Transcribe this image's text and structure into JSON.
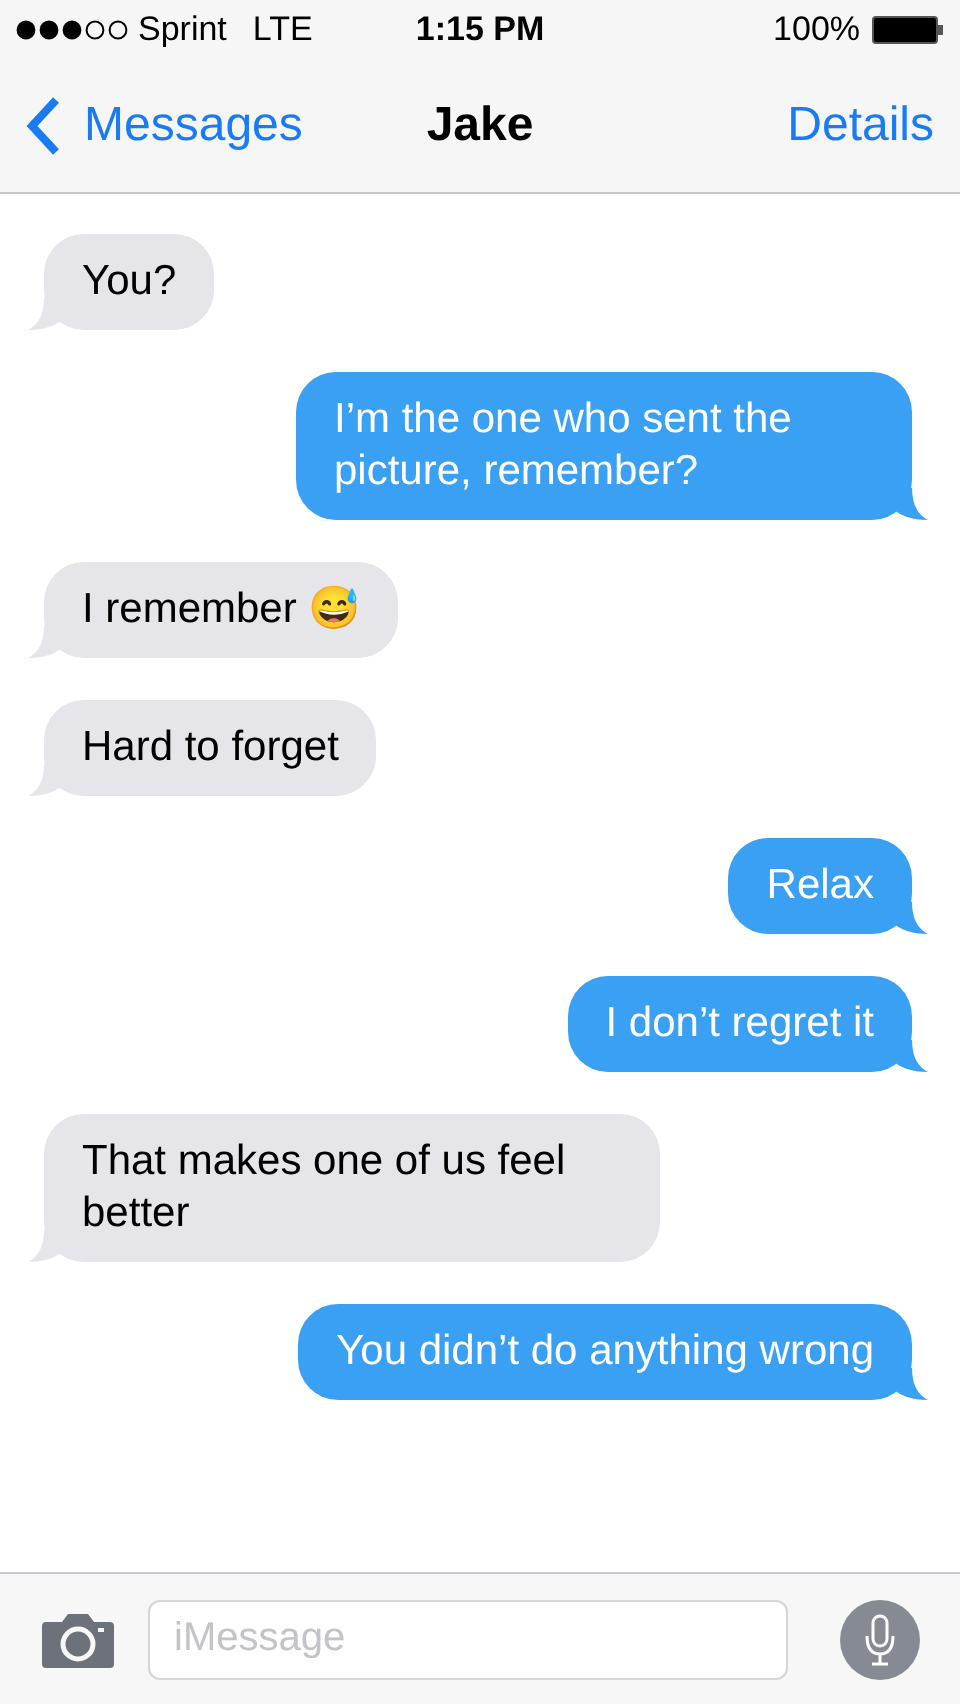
{
  "status_bar": {
    "carrier": "Sprint",
    "network": "LTE",
    "time": "1:15 PM",
    "battery": "100%"
  },
  "nav": {
    "back": "Messages",
    "title": "Jake",
    "action": "Details"
  },
  "messages": [
    {
      "kind": "received",
      "text": "You?"
    },
    {
      "kind": "sent",
      "text": "I’m the one who sent the picture, remember?"
    },
    {
      "kind": "received",
      "text": "I remember 😅"
    },
    {
      "kind": "received",
      "text": "Hard to forget"
    },
    {
      "kind": "sent",
      "text": "Relax"
    },
    {
      "kind": "sent",
      "text": "I don’t regret it"
    },
    {
      "kind": "received",
      "text": "That makes one of us feel better"
    },
    {
      "kind": "sent",
      "text": "You didn’t do anything wrong"
    }
  ],
  "composer": {
    "placeholder": "iMessage"
  }
}
